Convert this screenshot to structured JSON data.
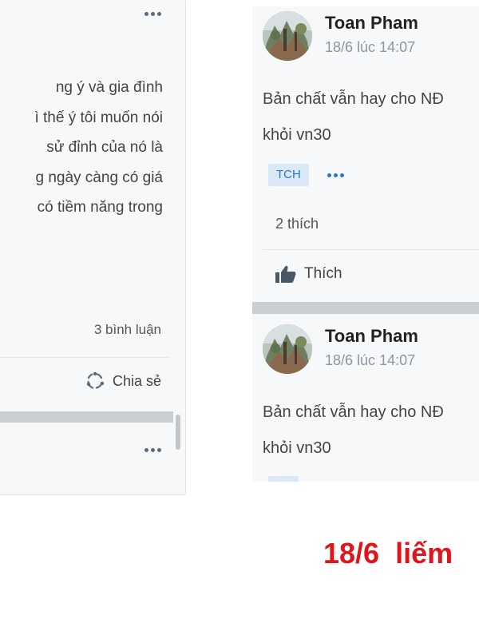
{
  "left_panel": {
    "body_lines": [
      "ng ý và gia đình",
      "ì thế ý tôi muốn nói",
      "sử đỉnh của nó là",
      "g ngày càng có giá",
      "có tiềm năng trong"
    ],
    "comments_label": "3 bình luận",
    "share_label": "Chia sẻ"
  },
  "posts": [
    {
      "author": "Toan Pham",
      "timestamp": "18/6 lúc 14:07",
      "text_lines": [
        "Bản chất vẫn hay cho NĐ",
        "khỏi vn30"
      ],
      "tag": "TCH",
      "likes": "2 thích",
      "like_label": "Thích"
    },
    {
      "author": "Toan Pham",
      "timestamp": "18/6 lúc 14:07",
      "text_lines": [
        "Bản chất vẫn hay cho NĐ",
        "khỏi vn30"
      ]
    }
  ],
  "caption": "18/6  liếm",
  "colors": {
    "accent": "#2b78c2",
    "tag_bg": "#dbe9f6",
    "caption": "#e0141b",
    "divider": "#c9ced3"
  },
  "icons": [
    "more-icon",
    "share-icon",
    "thumbs-up-icon",
    "avatar-image"
  ]
}
